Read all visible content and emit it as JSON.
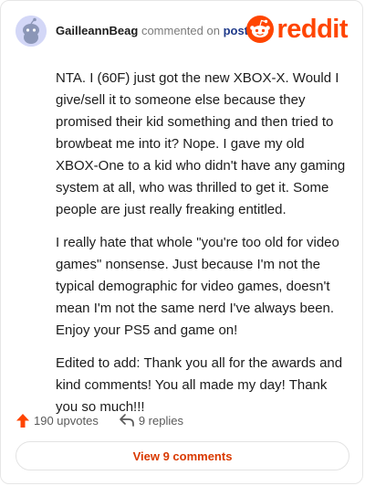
{
  "comment": {
    "username": "GailleannBeag",
    "action_text": "commented on",
    "post_link": "post",
    "brand": "reddit",
    "paragraphs": [
      "NTA. I (60F) just got the new XBOX-X. Would I give/sell it to someone else because they promised their kid something and then tried to browbeat me into it? Nope. I gave my old XBOX-One to a kid who didn't have any gaming system at all, who was thrilled to get it. Some people are just really freaking entitled.",
      "I really hate that whole \"you're too old for video games\" nonsense. Just because I'm not the typical demographic for video games, doesn't mean I'm not the same nerd I've always been. Enjoy your PS5 and game on!",
      "Edited to add: Thank you all for the awards and kind comments! You all made my day! Thank you so much!!!"
    ]
  },
  "footer": {
    "upvotes_label": "190 upvotes",
    "replies_label": "9 replies",
    "view_button": "View 9 comments"
  },
  "colors": {
    "brand": "#ff4500",
    "upvote": "#ff4500",
    "button_text": "#d93900"
  },
  "icons": {
    "avatar": "snoo-avatar-icon",
    "logo": "reddit-alien-icon",
    "upvote": "upvote-arrow-icon",
    "replies": "reply-arrow-icon"
  }
}
